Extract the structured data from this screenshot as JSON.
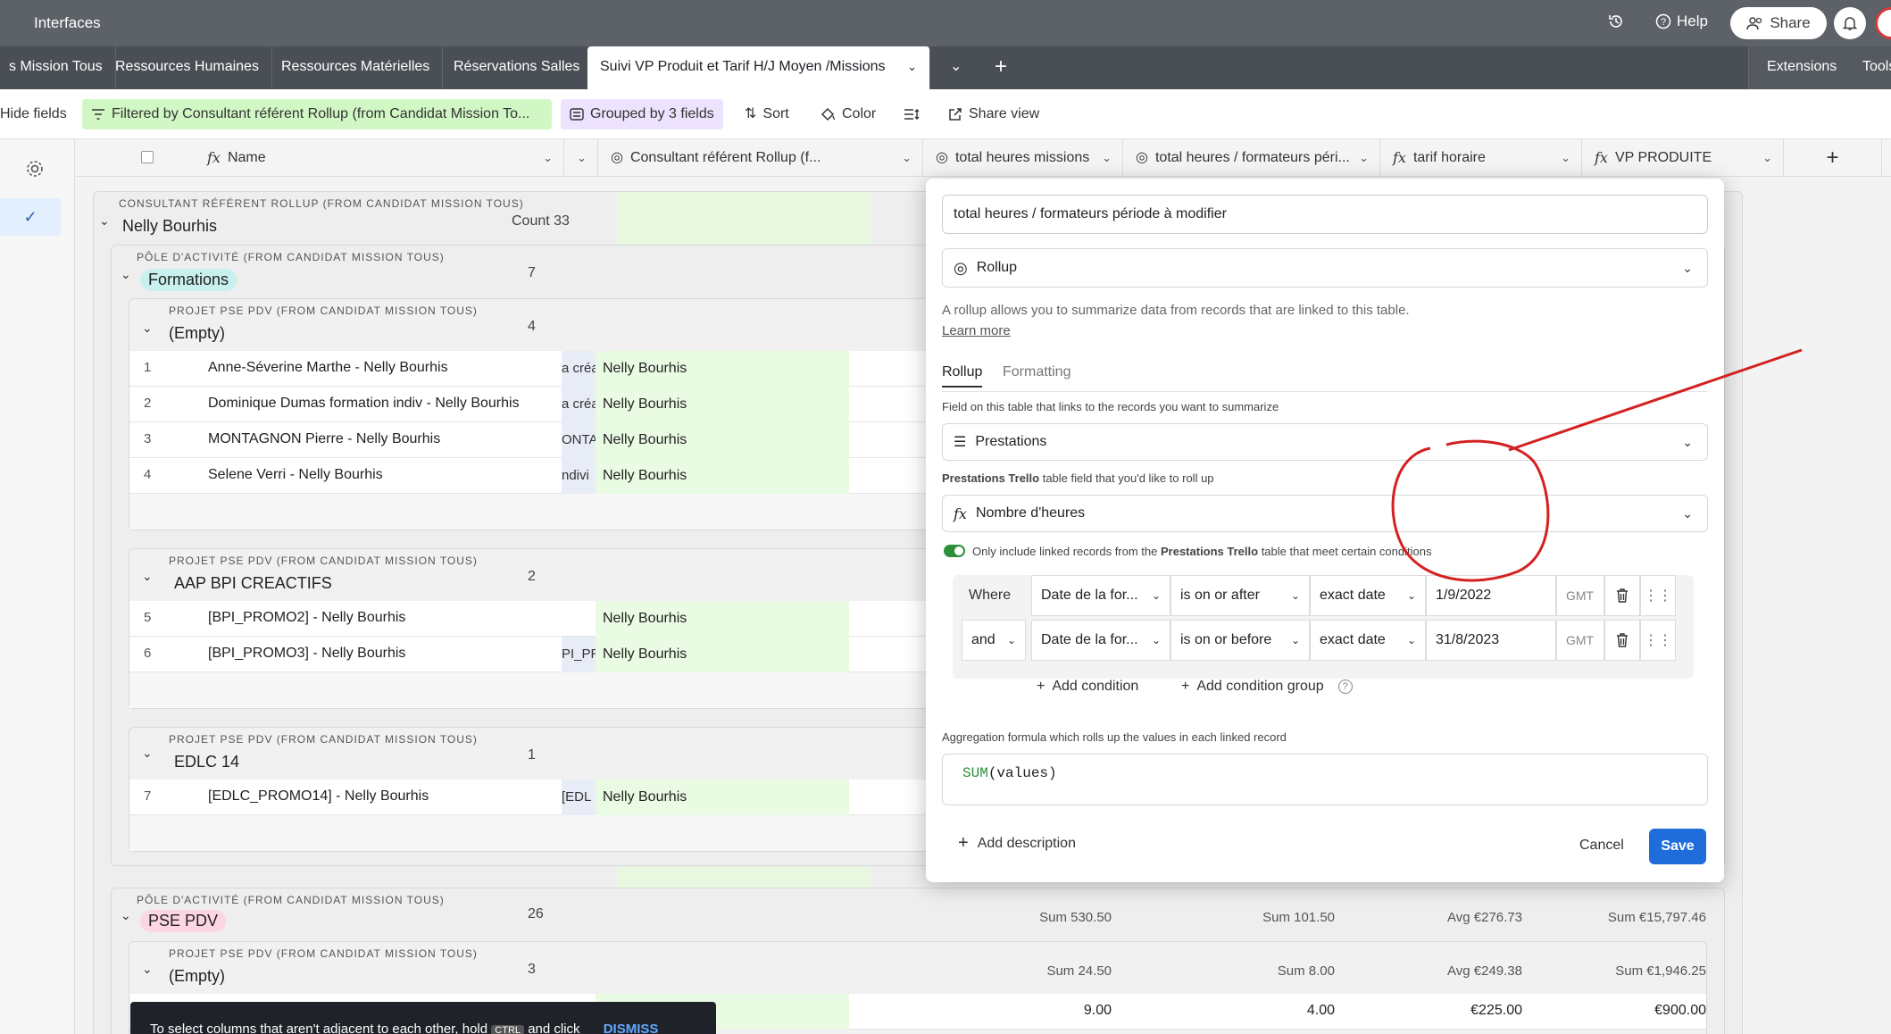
{
  "topbar": {
    "title": "Interfaces",
    "help_label": "Help",
    "share_label": "Share"
  },
  "tabs": [
    {
      "label": "s Mission Tous"
    },
    {
      "label": "Ressources Humaines"
    },
    {
      "label": "Ressources Matérielles"
    },
    {
      "label": "Réservations Salles"
    },
    {
      "label": "Suivi VP Produit et Tarif H/J Moyen /Missions"
    }
  ],
  "tabbar": {
    "extensions_label": "Extensions",
    "tools_label": "Tools"
  },
  "viewbar": {
    "hide_fields": "Hide fields",
    "filter": "Filtered by Consultant référent Rollup (from Candidat Mission To...",
    "group": "Grouped by 3 fields",
    "sort": "Sort",
    "color": "Color",
    "share_view": "Share view"
  },
  "columns": [
    {
      "label": "Name",
      "icon": "formula-icon"
    },
    {
      "label": "Consultant référent Rollup (f...",
      "icon": "rollup-icon"
    },
    {
      "label": "total heures missions",
      "icon": "rollup-icon"
    },
    {
      "label": "total heures / formateurs péri...",
      "icon": "rollup-icon"
    },
    {
      "label": "tarif horaire",
      "icon": "formula-icon"
    },
    {
      "label": "VP PRODUITE",
      "icon": "formula-icon"
    }
  ],
  "groups": {
    "g1": {
      "header": "CONSULTANT RÉFÉRENT ROLLUP (FROM CANDIDAT MISSION TOUS)",
      "name": "Nelly Bourhis",
      "count": "Count 33"
    },
    "g2": {
      "header": "PÔLE D'ACTIVITÉ (FROM CANDIDAT MISSION TOUS)",
      "name": "Formations",
      "count": "7"
    },
    "g3": {
      "header": "PROJET PSE PDV (FROM CANDIDAT MISSION TOUS)",
      "name": "(Empty)",
      "count": "4"
    },
    "g4": {
      "header": "PROJET PSE PDV (FROM CANDIDAT MISSION TOUS)",
      "name": "AAP BPI CREACTIFS",
      "count": "2"
    },
    "g5": {
      "header": "PROJET PSE PDV (FROM CANDIDAT MISSION TOUS)",
      "name": "EDLC 14",
      "count": "1"
    },
    "g6": {
      "header": "PÔLE D'ACTIVITÉ (FROM CANDIDAT MISSION TOUS)",
      "name": "PSE PDV",
      "count": "26"
    },
    "g7": {
      "header": "PROJET PSE PDV (FROM CANDIDAT MISSION TOUS)",
      "name": "(Empty)",
      "count": "3"
    }
  },
  "rows": [
    {
      "num": "1",
      "name": "Anne-Séverine Marthe - Nelly Bourhis",
      "trunc": "a créa",
      "consultant": "Nelly Bourhis"
    },
    {
      "num": "2",
      "name": "Dominique Dumas formation indiv - Nelly Bourhis",
      "trunc": "a créa",
      "consultant": "Nelly Bourhis"
    },
    {
      "num": "3",
      "name": "MONTAGNON Pierre - Nelly Bourhis",
      "trunc": "ONTA",
      "consultant": "Nelly Bourhis"
    },
    {
      "num": "4",
      "name": "Selene Verri - Nelly Bourhis",
      "trunc": "ndivi",
      "consultant": "Nelly Bourhis"
    },
    {
      "num": "5",
      "name": "[BPI_PROMO2] - Nelly Bourhis",
      "trunc": "",
      "consultant": "Nelly Bourhis"
    },
    {
      "num": "6",
      "name": "[BPI_PROMO3] - Nelly Bourhis",
      "trunc": "PI_PR",
      "consultant": "Nelly Bourhis"
    },
    {
      "num": "7",
      "name": "[EDLC_PROMO14] - Nelly Bourhis",
      "trunc": "[EDL",
      "consultant": "Nelly Bourhis"
    }
  ],
  "summaries": {
    "pse": {
      "hours": "Sum 530.50",
      "formateurs": "Sum 101.50",
      "tarif": "Avg €276.73",
      "vp": "Sum €15,797.46"
    },
    "empty": {
      "hours": "Sum 24.50",
      "formateurs": "Sum 8.00",
      "tarif": "Avg €249.38",
      "vp": "Sum €1,946.25"
    },
    "last_row": {
      "hours": "9.00",
      "formateurs": "4.00",
      "tarif": "€225.00",
      "vp": "€900.00"
    }
  },
  "dialog": {
    "field_name": "total heures / formateurs période à modifier",
    "field_type": "Rollup",
    "description": "A rollup allows you to summarize data from records that are linked to this table.",
    "learn_more": "Learn more",
    "tab_rollup": "Rollup",
    "tab_formatting": "Formatting",
    "link_label": "Field on this table that links to the records you want to summarize",
    "link_value": "Prestations",
    "rollup_label_bold": "Prestations Trello",
    "rollup_label_rest": " table field that you'd like to roll up",
    "rollup_value": "Nombre d'heures",
    "toggle_text_1": "Only include linked records from the ",
    "toggle_text_bold": "Prestations Trello",
    "toggle_text_2": " table that meet certain conditions",
    "conditions": [
      {
        "conj": "Where",
        "field": "Date de la for...",
        "op": "is on or after",
        "mode": "exact date",
        "value": "1/9/2022",
        "tz": "GMT"
      },
      {
        "conj": "and",
        "field": "Date de la for...",
        "op": "is on or before",
        "mode": "exact date",
        "value": "31/8/2023",
        "tz": "GMT"
      }
    ],
    "add_condition": "Add condition",
    "add_condition_group": "Add condition group",
    "aggregation_label": "Aggregation formula which rolls up the values in each linked record",
    "formula_fn": "SUM",
    "formula_args": "(values)",
    "add_description": "Add description",
    "cancel": "Cancel",
    "save": "Save"
  },
  "toast": {
    "text_1": "To select columns that aren't adjacent to each other, hold",
    "kbd": "CTRL",
    "text_2": "and click",
    "dismiss": "DISMISS"
  },
  "colors": {
    "accent": "#1e6ddb",
    "annotation": "#d42020",
    "toggle": "#2e8f3a",
    "formations_pill": "#c8f0ee",
    "pse_pill": "#fcd6e3"
  }
}
